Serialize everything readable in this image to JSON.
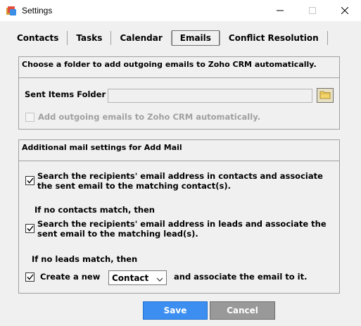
{
  "window": {
    "title": "Settings"
  },
  "tabs": [
    {
      "label": "Contacts"
    },
    {
      "label": "Tasks"
    },
    {
      "label": "Calendar"
    },
    {
      "label": "Emails",
      "active": true
    },
    {
      "label": "Conflict Resolution"
    }
  ],
  "sent_section": {
    "heading": "Choose a folder to add outgoing emails to Zoho CRM automatically.",
    "folder_label": "Sent Items Folder",
    "folder_value": "",
    "auto_add_label": "Add outgoing emails to Zoho CRM automatically.",
    "auto_add_checked": false,
    "auto_add_enabled": false
  },
  "add_mail_section": {
    "heading": "Additional mail settings for Add Mail",
    "contacts_line1": "Search the recipients' email address in contacts and associate",
    "contacts_line2": "the sent email to the matching contact(s).",
    "contacts_checked": true,
    "no_contacts_label": "If no contacts match, then",
    "leads_line1": "Search the recipients' email address in leads and associate the",
    "leads_line2": "sent email to the matching lead(s).",
    "leads_checked": true,
    "no_leads_label": "If no leads match, then",
    "create_new_label": "Create a new",
    "create_new_checked": true,
    "create_new_selected": "Contact",
    "associate_label": "and associate the email to it."
  },
  "buttons": {
    "save": "Save",
    "cancel": "Cancel"
  },
  "colors": {
    "save_bg": "#3c8ff0",
    "cancel_bg": "#999999",
    "window_bg": "#f0f0f0"
  }
}
